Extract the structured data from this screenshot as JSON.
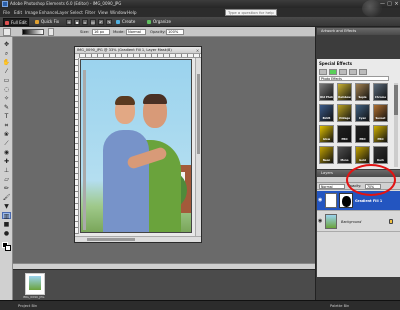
{
  "window": {
    "title": "Adobe Photoshop Elements 6.0 (Editor) - IMG_0090_JPG",
    "min": "—",
    "max": "□",
    "close": "×"
  },
  "menu": [
    "File",
    "Edit",
    "Image",
    "Enhance",
    "Layer",
    "Select",
    "Filter",
    "View",
    "Window",
    "Help"
  ],
  "help_placeholder": "Type a question for help",
  "modebar": {
    "full_edit": "Full Edit",
    "quick_fix": "Quick Fix",
    "create": "Create",
    "organize": "Organize"
  },
  "options": {
    "size_label": "Size:",
    "size_value": "16 px",
    "mode_label": "Mode:",
    "mode_value": "Normal",
    "opacity_label": "Opacity:",
    "opacity_value": "100%"
  },
  "document": {
    "title": "IMG_0090_JPG @ 33% (Gradient Fill 1, Layer Mask/8)"
  },
  "bin": {
    "caption": "IMG_0090_JPG"
  },
  "right_panel": {
    "header": "Artwork and Effects",
    "effects_title": "Special Effects",
    "effects_select": "Photo Effects",
    "layers_header": "Layers",
    "blend_mode": "Normal",
    "opacity_label": "Opacity:",
    "opacity_value": "70%",
    "layers": [
      {
        "name": "Gradient Fill 1",
        "selected": true
      },
      {
        "name": "Background",
        "selected": false
      }
    ]
  },
  "effects": [
    {
      "label": "Old Photo",
      "color": "#7a7a7a"
    },
    {
      "label": "Rainbow",
      "color": "#c8b030"
    },
    {
      "label": "Sepia",
      "color": "#a08050"
    },
    {
      "label": "Chrome",
      "color": "#5a6a7a"
    },
    {
      "label": "BLUR",
      "color": "#3a5a8a"
    },
    {
      "label": "Vintage",
      "color": "#b8a020"
    },
    {
      "label": "Cyan",
      "color": "#406080"
    },
    {
      "label": "Sunset",
      "color": "#b07030"
    },
    {
      "label": "Glow",
      "color": "#e0c000"
    },
    {
      "label": "PRO",
      "color": "#202020"
    },
    {
      "label": "PRO",
      "color": "#202020"
    },
    {
      "label": "PRO",
      "color": "#d0b000"
    },
    {
      "label": "Neon",
      "color": "#c0a000"
    },
    {
      "label": "Mono",
      "color": "#505050"
    },
    {
      "label": "Gold",
      "color": "#c0a000"
    },
    {
      "label": "Dark",
      "color": "#303030"
    }
  ],
  "effect_tiles_text": [
    "Chrome",
    "SEMO",
    "PRO Black & White",
    "PRO Rose Gold"
  ],
  "bottom_bar": {
    "left": "Project Bin",
    "right": "Palette Bin"
  }
}
